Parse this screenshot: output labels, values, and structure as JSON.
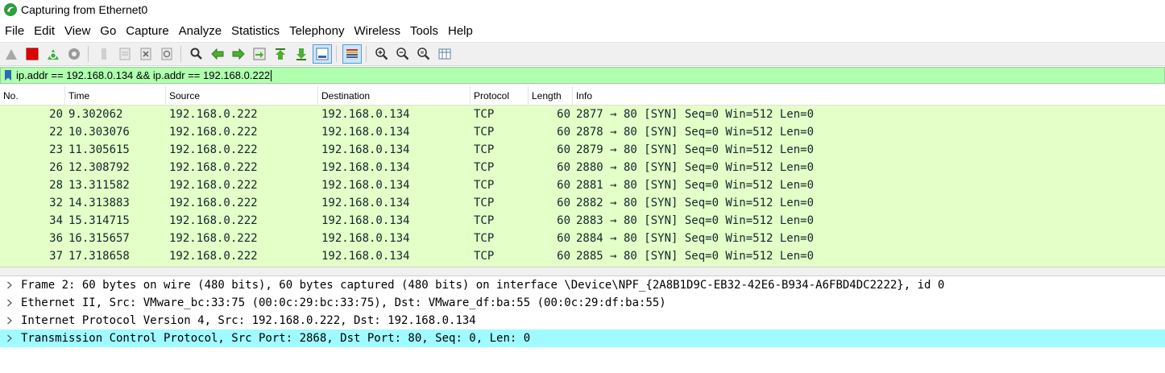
{
  "window": {
    "title": "Capturing from Ethernet0"
  },
  "menu": [
    "File",
    "Edit",
    "View",
    "Go",
    "Capture",
    "Analyze",
    "Statistics",
    "Telephony",
    "Wireless",
    "Tools",
    "Help"
  ],
  "toolbar_icons": [
    "start-capture-icon",
    "stop-capture-icon",
    "restart-capture-icon",
    "capture-options-icon",
    "open-file-icon",
    "save-file-icon",
    "close-file-icon",
    "reload-file-icon",
    "find-packet-icon",
    "go-back-icon",
    "go-forward-icon",
    "go-to-packet-icon",
    "go-first-icon",
    "go-last-icon",
    "autoscroll-icon",
    "colorize-icon",
    "zoom-in-icon",
    "zoom-out-icon",
    "normal-size-icon",
    "resize-columns-icon"
  ],
  "filter": {
    "value": "ip.addr == 192.168.0.134 && ip.addr == 192.168.0.222",
    "bg_color": "#afffaf"
  },
  "columns": [
    "No.",
    "Time",
    "Source",
    "Destination",
    "Protocol",
    "Length",
    "Info"
  ],
  "packets": [
    {
      "no": "20",
      "time": "9.302062",
      "source": "192.168.0.222",
      "destination": "192.168.0.134",
      "protocol": "TCP",
      "length": "60",
      "info": "2877 → 80 [SYN] Seq=0 Win=512 Len=0"
    },
    {
      "no": "22",
      "time": "10.303076",
      "source": "192.168.0.222",
      "destination": "192.168.0.134",
      "protocol": "TCP",
      "length": "60",
      "info": "2878 → 80 [SYN] Seq=0 Win=512 Len=0"
    },
    {
      "no": "23",
      "time": "11.305615",
      "source": "192.168.0.222",
      "destination": "192.168.0.134",
      "protocol": "TCP",
      "length": "60",
      "info": "2879 → 80 [SYN] Seq=0 Win=512 Len=0"
    },
    {
      "no": "26",
      "time": "12.308792",
      "source": "192.168.0.222",
      "destination": "192.168.0.134",
      "protocol": "TCP",
      "length": "60",
      "info": "2880 → 80 [SYN] Seq=0 Win=512 Len=0"
    },
    {
      "no": "28",
      "time": "13.311582",
      "source": "192.168.0.222",
      "destination": "192.168.0.134",
      "protocol": "TCP",
      "length": "60",
      "info": "2881 → 80 [SYN] Seq=0 Win=512 Len=0"
    },
    {
      "no": "32",
      "time": "14.313883",
      "source": "192.168.0.222",
      "destination": "192.168.0.134",
      "protocol": "TCP",
      "length": "60",
      "info": "2882 → 80 [SYN] Seq=0 Win=512 Len=0"
    },
    {
      "no": "34",
      "time": "15.314715",
      "source": "192.168.0.222",
      "destination": "192.168.0.134",
      "protocol": "TCP",
      "length": "60",
      "info": "2883 → 80 [SYN] Seq=0 Win=512 Len=0"
    },
    {
      "no": "36",
      "time": "16.315657",
      "source": "192.168.0.222",
      "destination": "192.168.0.134",
      "protocol": "TCP",
      "length": "60",
      "info": "2884 → 80 [SYN] Seq=0 Win=512 Len=0"
    },
    {
      "no": "37",
      "time": "17.318658",
      "source": "192.168.0.222",
      "destination": "192.168.0.134",
      "protocol": "TCP",
      "length": "60",
      "info": "2885 → 80 [SYN] Seq=0 Win=512 Len=0"
    }
  ],
  "packet_row_color": "#e4ffc7",
  "details": [
    {
      "text": "Frame 2: 60 bytes on wire (480 bits), 60 bytes captured (480 bits) on interface \\Device\\NPF_{2A8B1D9C-EB32-42E6-B934-A6FBD4DC2222}, id 0",
      "selected": false
    },
    {
      "text": "Ethernet II, Src: VMware_bc:33:75 (00:0c:29:bc:33:75), Dst: VMware_df:ba:55 (00:0c:29:df:ba:55)",
      "selected": false
    },
    {
      "text": "Internet Protocol Version 4, Src: 192.168.0.222, Dst: 192.168.0.134",
      "selected": false
    },
    {
      "text": "Transmission Control Protocol, Src Port: 2868, Dst Port: 80, Seq: 0, Len: 0",
      "selected": true
    }
  ],
  "selected_detail_color": "#9ffbff"
}
